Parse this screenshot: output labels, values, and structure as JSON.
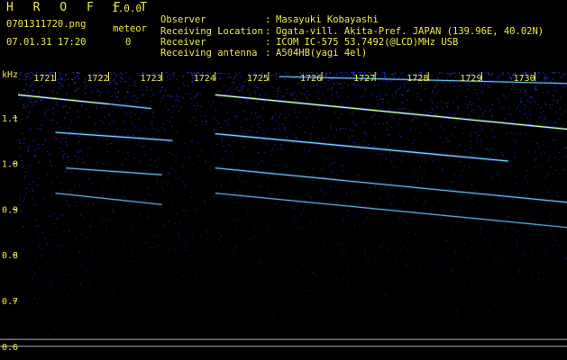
{
  "header": {
    "app_name": "H R O F F T",
    "version": "1.0.0",
    "file_name": "0701311720.png",
    "meteor_label": "meteor",
    "date_time": "07.01.31 17:20",
    "meteor_count": "0",
    "info": [
      {
        "key": "Observer",
        "value": "Masayuki Kobayashi"
      },
      {
        "key": "Receiving Location",
        "value": "Ogata-vill. Akita-Pref. JAPAN (139.96E, 40.02N)"
      },
      {
        "key": "Receiver",
        "value": "ICOM IC-575 53.7492(@LCD)MHz USB"
      },
      {
        "key": "Receiving antenna",
        "value": "A504HB(yagi 4el)"
      }
    ]
  },
  "chart_data": {
    "type": "heatmap",
    "title": "",
    "xlabel": "",
    "ylabel": "kHz",
    "x_tick_labels": [
      "1721",
      "1722",
      "1723",
      "1724",
      "1725",
      "1726",
      "1727",
      "1728",
      "1729",
      "1730"
    ],
    "y_tick_labels": [
      "1.1",
      "1.0",
      "0.9",
      "0.8",
      "0.7",
      "0.6"
    ],
    "y_ticks": [
      1.1,
      1.0,
      0.9,
      0.8,
      0.7,
      0.6
    ],
    "xlim": [
      1720.3,
      1730.6
    ],
    "ylim": [
      0.57,
      1.2
    ],
    "background_color": "#000014",
    "noise_color": "#2a3cff",
    "grid": false,
    "traces": [
      {
        "x": [
          1720.3,
          1722.0
        ],
        "y": [
          1.15,
          1.13
        ],
        "intensity": 1.0
      },
      {
        "x": [
          1722.0,
          1722.8
        ],
        "y": [
          1.13,
          1.12
        ],
        "intensity": 0.7
      },
      {
        "x": [
          1724.0,
          1730.6
        ],
        "y": [
          1.15,
          1.075
        ],
        "intensity": 1.0
      },
      {
        "x": [
          1721.0,
          1723.2
        ],
        "y": [
          1.068,
          1.05
        ],
        "intensity": 0.8
      },
      {
        "x": [
          1724.0,
          1729.5
        ],
        "y": [
          1.065,
          1.005
        ],
        "intensity": 0.85
      },
      {
        "x": [
          1721.2,
          1723.0
        ],
        "y": [
          0.99,
          0.975
        ],
        "intensity": 0.55
      },
      {
        "x": [
          1724.0,
          1730.6
        ],
        "y": [
          0.99,
          0.915
        ],
        "intensity": 0.6
      },
      {
        "x": [
          1721.0,
          1723.0
        ],
        "y": [
          0.935,
          0.91
        ],
        "intensity": 0.45
      },
      {
        "x": [
          1724.0,
          1730.6
        ],
        "y": [
          0.935,
          0.86
        ],
        "intensity": 0.45
      },
      {
        "x": [
          1725.2,
          1730.6
        ],
        "y": [
          1.19,
          1.175
        ],
        "intensity": 0.6
      }
    ],
    "reference_lines": [
      0.615,
      0.6
    ],
    "reference_line_color": "#b4b4b4"
  }
}
